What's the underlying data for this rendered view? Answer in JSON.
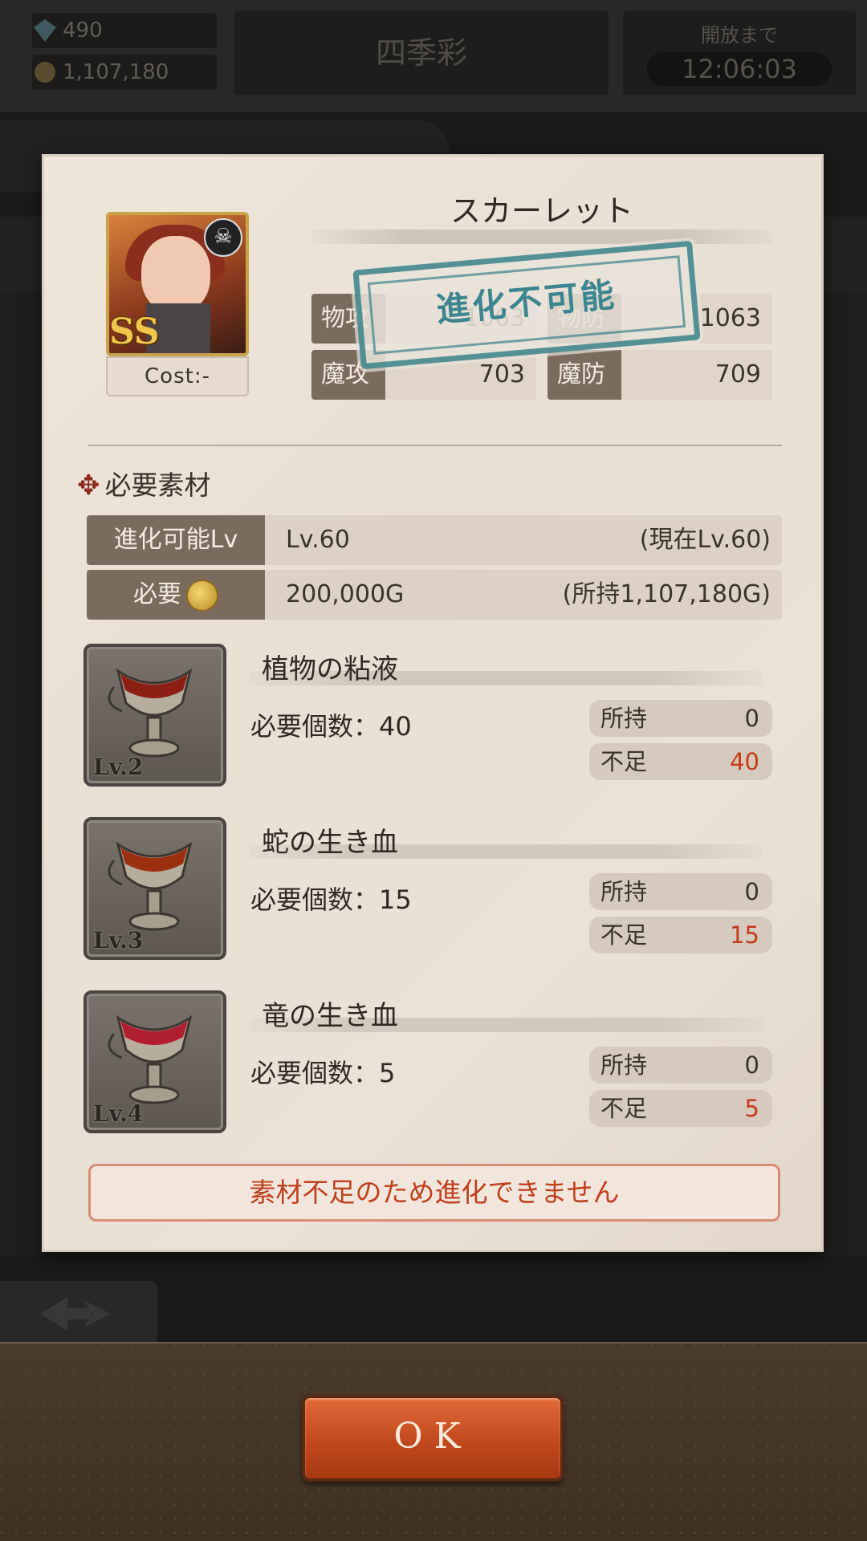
{
  "header": {
    "gems": "490",
    "gold": "1,107,180",
    "title": "四季彩",
    "timer_label": "開放まで",
    "timer_value": "12:06:03"
  },
  "dialog": {
    "character": {
      "name": "スカーレット",
      "rarity": "SS",
      "cost": "Cost:-"
    },
    "stats": [
      {
        "label": "物攻",
        "value": "1063"
      },
      {
        "label": "物防",
        "value": "1063"
      },
      {
        "label": "魔攻",
        "value": "703"
      },
      {
        "label": "魔防",
        "value": "709"
      }
    ],
    "stamp_text": "進化不可能",
    "section_title": "必要素材",
    "requirements": {
      "level_label": "進化可能Lv",
      "level_value": "Lv.60",
      "level_current": "(現在Lv.60)",
      "gold_label": "必要",
      "gold_value": "200,000G",
      "gold_owned": "(所持1,107,180G)"
    },
    "materials": [
      {
        "name": "植物の粘液",
        "level": "Lv.2",
        "need": "必要個数：40",
        "owned_label": "所持",
        "owned": "0",
        "short_label": "不足",
        "short": "40",
        "liquid": "#8c1f14"
      },
      {
        "name": "蛇の生き血",
        "level": "Lv.3",
        "need": "必要個数：15",
        "owned_label": "所持",
        "owned": "0",
        "short_label": "不足",
        "short": "15",
        "liquid": "#9a3010"
      },
      {
        "name": "竜の生き血",
        "level": "Lv.4",
        "need": "必要個数：5",
        "owned_label": "所持",
        "owned": "0",
        "short_label": "不足",
        "short": "5",
        "liquid": "#b01e30"
      }
    ],
    "warning": "素材不足のため進化できません"
  },
  "ok_label": "OK",
  "colors": {
    "accent_red": "#c43a1a",
    "stamp_teal": "#3d8590",
    "label_brown": "#7a6b5d"
  }
}
